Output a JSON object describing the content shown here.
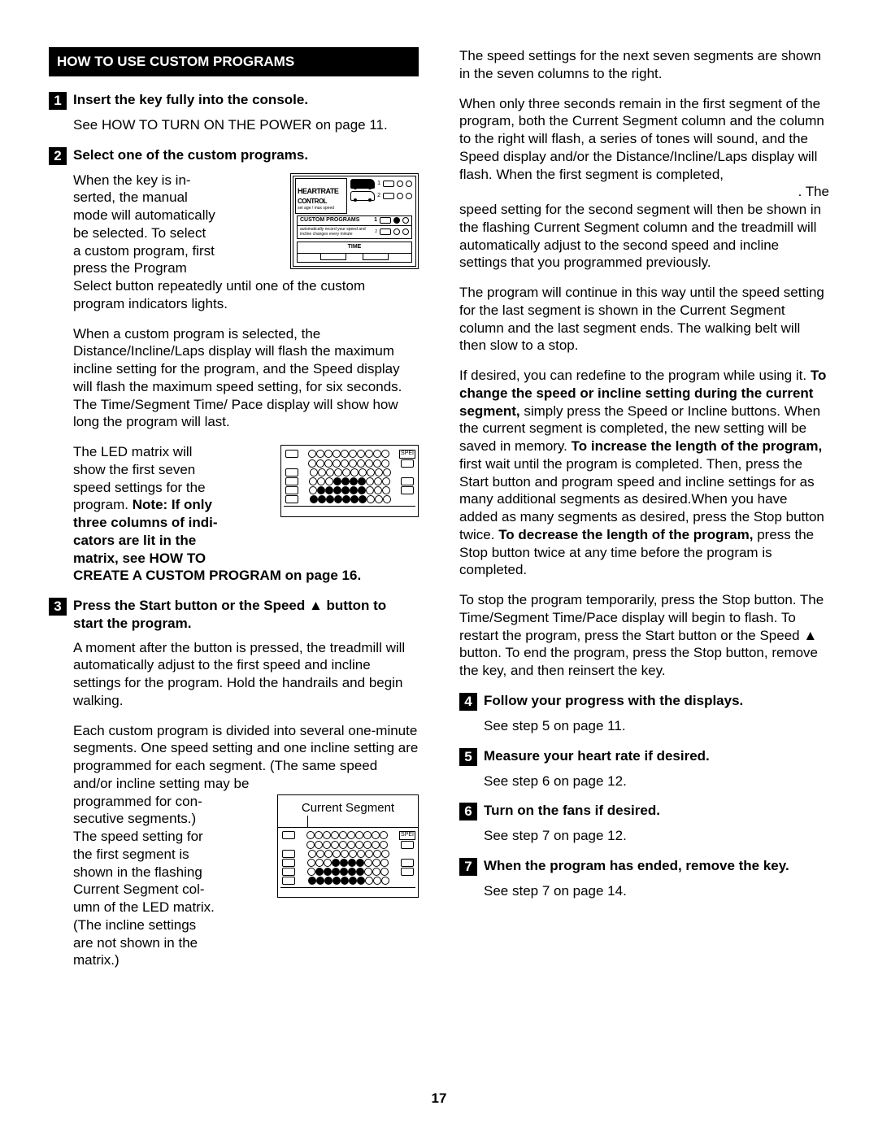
{
  "section_title": "HOW TO USE CUSTOM PROGRAMS",
  "page_number": "17",
  "steps": {
    "1": {
      "num": "1",
      "title": "Insert the key fully into the console.",
      "p1": "See HOW TO TURN ON THE POWER on page 11."
    },
    "2": {
      "num": "2",
      "title": "Select one of the custom programs.",
      "p1a": "When the key is in-",
      "p1b": "serted, the manual",
      "p1c": "mode will automatically",
      "p1d": "be selected. To select",
      "p1e": "a custom program, first",
      "p1f": "press the Program",
      "p1g": "Select button repeatedly until one of the custom program indicators lights.",
      "p2": "When a custom program is selected, the Distance/Incline/Laps display will flash the maximum incline setting for the program, and the Speed display will flash the maximum speed setting, for six seconds. The Time/Segment Time/ Pace display will show how long the program will last.",
      "p3a": "The LED matrix will",
      "p3b": "show the first seven",
      "p3c": "speed settings for the",
      "p3d": "program. ",
      "note1": "Note: If only",
      "note2": "three columns of indi-",
      "note3": "cators are lit in the",
      "note4": "matrix, see HOW TO",
      "note_tail": "CREATE A CUSTOM PROGRAM on page 16."
    },
    "3": {
      "num": "3",
      "title": "Press the Start button or the Speed ▲ button to start the program.",
      "p1": "A moment after the button is pressed, the treadmill will automatically adjust to the first speed and incline settings for the program. Hold the handrails and begin walking.",
      "p2a": "Each custom program is divided into several one-minute segments. One speed setting and one incline setting are programmed for each segment. (The same speed and/or incline setting may be",
      "p2b": "programmed for con-",
      "p2c": "secutive segments.)",
      "p2d": "The speed setting for",
      "p2e": "the first segment is",
      "p2f": "shown in the flashing",
      "p2g": "Current Segment col-",
      "p2h": "umn of the LED matrix.",
      "p2i": "(The incline settings",
      "p2j": "are not shown in the",
      "p2k": "matrix.)"
    },
    "4": {
      "num": "4",
      "title": "Follow your progress with the displays.",
      "p1": "See step 5 on page 11."
    },
    "5": {
      "num": "5",
      "title": "Measure your heart rate if desired.",
      "p1": "See step 6 on page 12."
    },
    "6": {
      "num": "6",
      "title": "Turn on the fans if desired.",
      "p1": "See step 7 on page 12."
    },
    "7": {
      "num": "7",
      "title": "When the program has ended, remove the key.",
      "p1": "See step 7 on page 14."
    }
  },
  "right": {
    "p1": "The speed settings for the next seven segments are shown in the seven columns to the right.",
    "p2a": "When only three seconds remain in the first segment of the program, both the Current Segment column and the column to the right will flash, a series of tones will sound, and the Speed display and/or the Distance/Incline/Laps display will flash. When the first segment is completed,",
    "p2b": ". The",
    "p3": "speed setting for the second segment will then be shown in the flashing Current Segment column and the treadmill will automatically adjust to the second speed and incline settings that you programmed previously.",
    "p4": "The program will continue in this way until the speed setting for the last segment is shown in the Current Segment column and the last segment ends. The walking belt will then slow to a stop.",
    "p5a": "If desired, you can redefine to the program while using it. ",
    "p5b": "To change the speed or incline setting during the current segment,",
    "p5c": " simply press the Speed or Incline buttons. When the current segment is completed, the new setting will be saved in memory. ",
    "p5d": "To increase the length of the program,",
    "p5e": " first wait until the program is completed. Then, press the Start button and program speed and incline settings for as many additional segments as desired.When you have added as many segments as desired, press the Stop button twice. ",
    "p5f": "To decrease the length of the program,",
    "p5g": " press the Stop button twice at any time before the program is completed.",
    "p6": "To stop the program temporarily, press the Stop button. The Time/Segment Time/Pace display will begin to flash. To restart the program, press the Start button or the Speed ▲ button. To end the program, press the Stop button, remove the key, and then reinsert the key."
  },
  "fig1": {
    "heartrate": "HEART",
    "rate": "RATE",
    "control": "CONTROL",
    "sub": "set age / max speed",
    "num1": "1",
    "num2": "2",
    "cp": "CUSTOM PROGRAMS",
    "cp_sub": "automatically record your speed and incline changes every minute",
    "time": "TIME"
  },
  "fig2": {
    "speed": "SPEI"
  },
  "fig3": {
    "label": "Current Segment",
    "speed": "SPEI"
  }
}
